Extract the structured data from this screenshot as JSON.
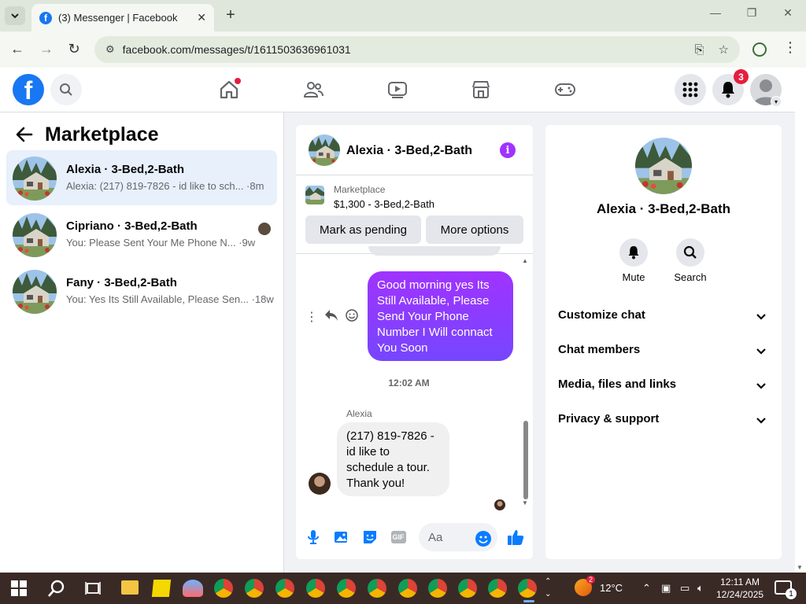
{
  "browser": {
    "tab_title": "(3) Messenger | Facebook",
    "favicon_letter": "f",
    "url": "facebook.com/messages/t/1611503636961031"
  },
  "header": {
    "logo_letter": "f",
    "notification_count": "3"
  },
  "sidebar": {
    "title": "Marketplace",
    "conversations": [
      {
        "name": "Alexia · 3-Bed,2-Bath",
        "preview": "Alexia: (217) 819-7826 - id like to sch... ·8m",
        "active": true
      },
      {
        "name": "Cipriano · 3-Bed,2-Bath",
        "preview": "You: Please Sent Your Me Phone N... ·9w",
        "active": false
      },
      {
        "name": "Fany · 3-Bed,2-Bath",
        "preview": "You: Yes Its Still Available, Please Sen... ·18w",
        "active": false
      }
    ]
  },
  "chat": {
    "title": "Alexia · 3-Bed,2-Bath",
    "listing_source": "Marketplace",
    "listing_price": "$1,300 - 3-Bed,2-Bath",
    "mark_pending_label": "Mark as pending",
    "more_options_label": "More options",
    "outgoing_message": "Good morning yes Its Still Available, Please Send Your Phone Number I Will connact You Soon",
    "timestamp": "12:02 AM",
    "sender_name": "Alexia",
    "incoming_message": "(217) 819-7826 - id like to schedule a tour. Thank you!",
    "composer_placeholder": "Aa",
    "gif_label": "GIF"
  },
  "details": {
    "name": "Alexia · 3-Bed,2-Bath",
    "mute_label": "Mute",
    "search_label": "Search",
    "sections": [
      "Customize chat",
      "Chat members",
      "Media, files and links",
      "Privacy & support"
    ]
  },
  "taskbar": {
    "temperature": "12°C",
    "weather_badge": "2",
    "time": "12:11 AM",
    "date": "12/24/2025",
    "notification_count": "1"
  },
  "colors": {
    "facebook_blue": "#1877f2",
    "messenger_purple": "#a033ff",
    "notification_red": "#e41e3f"
  }
}
